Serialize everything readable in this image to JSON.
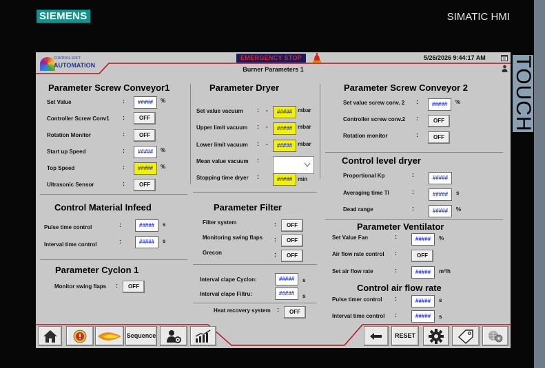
{
  "device": {
    "brand": "SIEMENS",
    "model": "SIMATIC HMI",
    "side_label": "TOUCH"
  },
  "header": {
    "logo_sub": "CONTROL SOFT",
    "logo_main": "AUTOMATION",
    "emergency": "EMERGENCY STOP",
    "title": "Burner Parameters 1",
    "datetime": "5/26/2026 9:44:17 AM"
  },
  "colors": {
    "screen_bg": "#c8c8c8",
    "accent_red": "#b3121b",
    "field_value": "#1f2fd0",
    "highlight": "#f3f300"
  },
  "conv1": {
    "title": "Parameter Screw Conveyor1",
    "set_value": {
      "label": "Set Value",
      "value": "#####",
      "unit": "%"
    },
    "controller": {
      "label": "Controller Screw Conv1",
      "value": "OFF"
    },
    "rotation": {
      "label": "Rotation Monitor",
      "value": "OFF"
    },
    "startup": {
      "label": "Start up Speed",
      "value": "#####",
      "unit": "%"
    },
    "top": {
      "label": "Top Speed",
      "value": "#####",
      "unit": "%"
    },
    "ultrasonic": {
      "label": "Ultrasonic Sensor",
      "value": "OFF"
    }
  },
  "infeed": {
    "title": "Control Material Infeed",
    "pulse": {
      "label": "Pulse time control",
      "value": "#####",
      "unit": "s"
    },
    "interval": {
      "label": "Interval time control",
      "value": "#####",
      "unit": "s"
    }
  },
  "cyclon": {
    "title": "Parameter Cyclon 1",
    "monitor": {
      "label": "Monitor swing flaps",
      "value": "OFF"
    }
  },
  "dryer": {
    "title": "Parameter Dryer",
    "set_vacuum": {
      "label": "Set value vacuum",
      "sign": "-",
      "value": "#####",
      "unit": "mbar"
    },
    "upper": {
      "label": "Upper limit vacuum",
      "sign": "-",
      "value": "#####",
      "unit": "mbar"
    },
    "lower": {
      "label": "Lower limit vacuum",
      "sign": "-",
      "value": "#####",
      "unit": "mbar"
    },
    "mean": {
      "label": "Mean value vacuum"
    },
    "stopping": {
      "label": "Stopping time dryer",
      "value": "#####",
      "unit": "min"
    }
  },
  "filter": {
    "title": "Parameter Filter",
    "system": {
      "label": "Filter system",
      "value": "OFF"
    },
    "monitoring": {
      "label": "Monitoring swing flaps",
      "value": "OFF"
    },
    "grecon": {
      "label": "Grecon",
      "value": "OFF"
    },
    "clape_cyclon": {
      "label": "Interval clape Cyclon:",
      "value": "#####",
      "unit": "s"
    },
    "clape_filtru": {
      "label": "Interval clape Filtru:",
      "value": "#####",
      "unit": "s"
    },
    "heat_recovery": {
      "label": "Heat recovery system",
      "value": "OFF"
    }
  },
  "conv2": {
    "title": "Parameter Screw Conveyor 2",
    "set_value": {
      "label": "Set value screw conv. 2",
      "value": "#####",
      "unit": "%"
    },
    "controller": {
      "label": "Controller screw conv.2",
      "value": "OFF"
    },
    "rotation": {
      "label": "Rotation monitor",
      "value": "OFF"
    }
  },
  "level": {
    "title": "Control level dryer",
    "kp": {
      "label": "Proportional Kp",
      "value": "#####"
    },
    "ti": {
      "label": "Averaging time TI",
      "value": "#####",
      "unit": "s"
    },
    "dead": {
      "label": "Dead range",
      "value": "#####",
      "unit": "%"
    }
  },
  "ventilator": {
    "title": "Parameter Ventilator",
    "set_fan": {
      "label": "Set Value Fan",
      "value": "#####",
      "unit": "%"
    },
    "air_rate": {
      "label": "Air flow rate control",
      "value": "OFF"
    },
    "set_air": {
      "label": "Set air flow rate",
      "value": "#####",
      "unit": "m³/h"
    }
  },
  "airflow": {
    "title": "Control air flow rate",
    "pulse": {
      "label": "Pulse timer control",
      "value": "#####",
      "unit": "s"
    },
    "interval": {
      "label": "Interval time control",
      "value": "#####",
      "unit": "s"
    }
  },
  "toolbar": {
    "sequence": "Sequence",
    "reset": "RESET",
    "icons": [
      "home-icon",
      "emergency-icon",
      "flame-icon",
      "user-settings-icon",
      "trend-icon",
      "back-icon",
      "gear-icon",
      "tag-icon",
      "network-settings-icon"
    ]
  },
  "colon": ":"
}
